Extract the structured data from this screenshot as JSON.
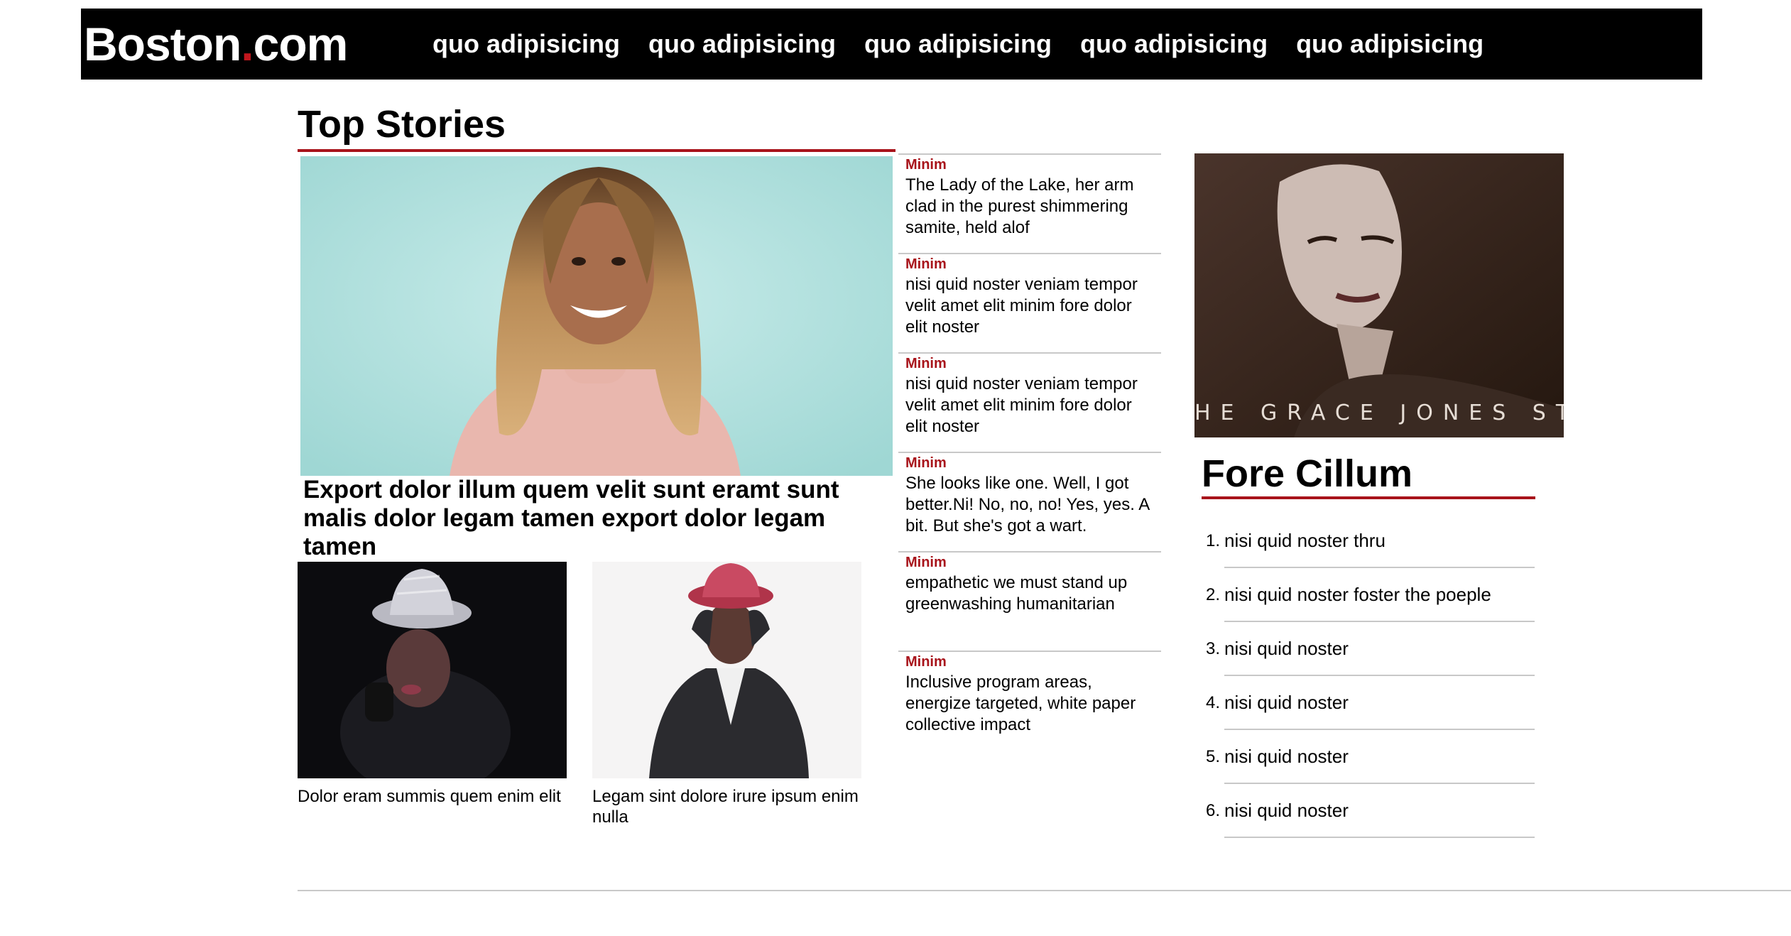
{
  "header": {
    "logo_main": "Boston",
    "logo_dot": ".",
    "logo_tld": "com",
    "nav": [
      {
        "label": "quo adipisicing"
      },
      {
        "label": "quo adipisicing"
      },
      {
        "label": "quo adipisicing"
      },
      {
        "label": "quo adipisicing"
      },
      {
        "label": "quo adipisicing"
      }
    ]
  },
  "top_stories": {
    "title": "Top Stories",
    "lead": {
      "headline": "Export dolor illum quem velit sunt eramt sunt malis dolor legam tamen export dolor legam tamen"
    },
    "small": [
      {
        "caption": "Dolor eram summis quem enim elit"
      },
      {
        "caption": "Legam sint dolore irure ipsum enim nulla"
      }
    ]
  },
  "sidebar_list": [
    {
      "kicker": "Minim",
      "text": "The Lady of the Lake, her arm clad in the purest shimmering samite, held alof"
    },
    {
      "kicker": "Minim",
      "text": "nisi quid noster veniam tempor velit amet elit minim fore dolor elit noster"
    },
    {
      "kicker": "Minim",
      "text": "nisi quid noster veniam tempor velit amet elit minim fore dolor elit noster"
    },
    {
      "kicker": "Minim",
      "text": "She looks like one. Well, I got better.Ni! No, no, no! Yes, yes. A bit. But she's got a wart."
    },
    {
      "kicker": "Minim",
      "text": "empathetic we must stand up greenwashing humanitarian"
    },
    {
      "kicker": "Minim",
      "text": "Inclusive program areas, energize targeted, white paper collective impact"
    }
  ],
  "feature": {
    "image_caption": "HE GRACE JONES STORY"
  },
  "fore_cillum": {
    "title": "Fore Cillum",
    "items": [
      {
        "num": "1.",
        "text": "nisi quid noster thru"
      },
      {
        "num": "2.",
        "text": "nisi quid noster foster the poeple"
      },
      {
        "num": "3.",
        "text": "nisi quid noster"
      },
      {
        "num": "4.",
        "text": "nisi quid noster"
      },
      {
        "num": "5.",
        "text": "nisi quid noster"
      },
      {
        "num": "6.",
        "text": "nisi quid noster"
      }
    ]
  },
  "colors": {
    "accent": "#a8141b",
    "header_bg": "#000000",
    "rule": "#c8c8c8"
  }
}
